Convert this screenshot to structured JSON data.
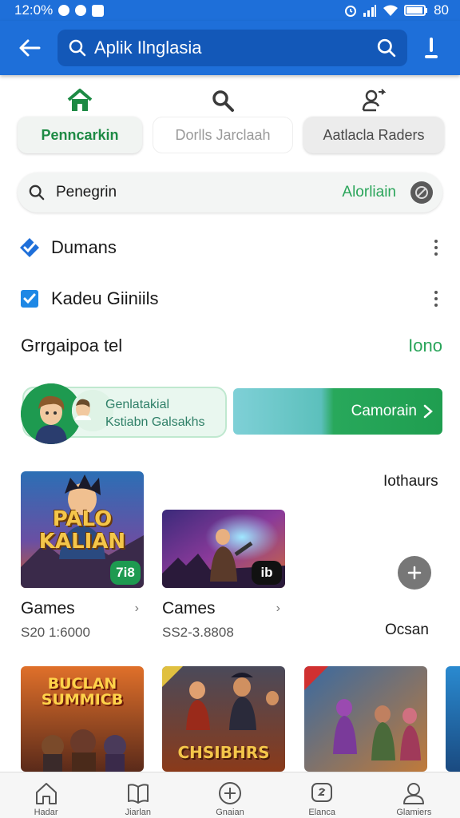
{
  "statusbar": {
    "time": "12:0%",
    "battery": "80"
  },
  "appbar": {
    "search_label": "Aplik Ilnglasia"
  },
  "tabs": [
    {
      "label": "Penncarkin",
      "icon": "home-icon"
    },
    {
      "label": "Dorlls Jarclaah",
      "icon": "search-icon"
    },
    {
      "label": "Aatlacla Raders",
      "icon": "person-arrow-icon"
    }
  ],
  "filter": {
    "label": "Penegrin",
    "action": "Alorliain"
  },
  "options": [
    {
      "label": "Dumans"
    },
    {
      "label": "Kadeu Giiniils"
    }
  ],
  "section": {
    "title": "Grrgaipoa tel",
    "link": "Iono"
  },
  "promo": {
    "line1": "Genlatakial",
    "line2": "Kstiabn Galsakhs",
    "button": "Camorain"
  },
  "more": {
    "label": "Iothaurs",
    "caption": "Ocsan"
  },
  "games": [
    {
      "title_art": "PALO KALIAN",
      "name": "Games",
      "price": "S20 1:6000",
      "badge": "7i8"
    },
    {
      "title_art": "",
      "name": "Cames",
      "price": "SS2-3.8808",
      "badge": "ib"
    }
  ],
  "bottom_games": [
    {
      "title_art": "BUCLAN SUMMICB"
    },
    {
      "title_art": "CHSIBHRS"
    },
    {
      "title_art": ""
    }
  ],
  "nav": [
    {
      "label": "Hadar",
      "icon": "home-icon"
    },
    {
      "label": "Jiarlan",
      "icon": "book-icon"
    },
    {
      "label": "Gnaian",
      "icon": "plus-circle-icon"
    },
    {
      "label": "Elanca",
      "icon": "chat-icon"
    },
    {
      "label": "Glamiers",
      "icon": "profile-icon"
    }
  ],
  "colors": {
    "primary": "#1e6fd9",
    "primary_dark": "#1358b8",
    "accent_green": "#2aa55a"
  }
}
